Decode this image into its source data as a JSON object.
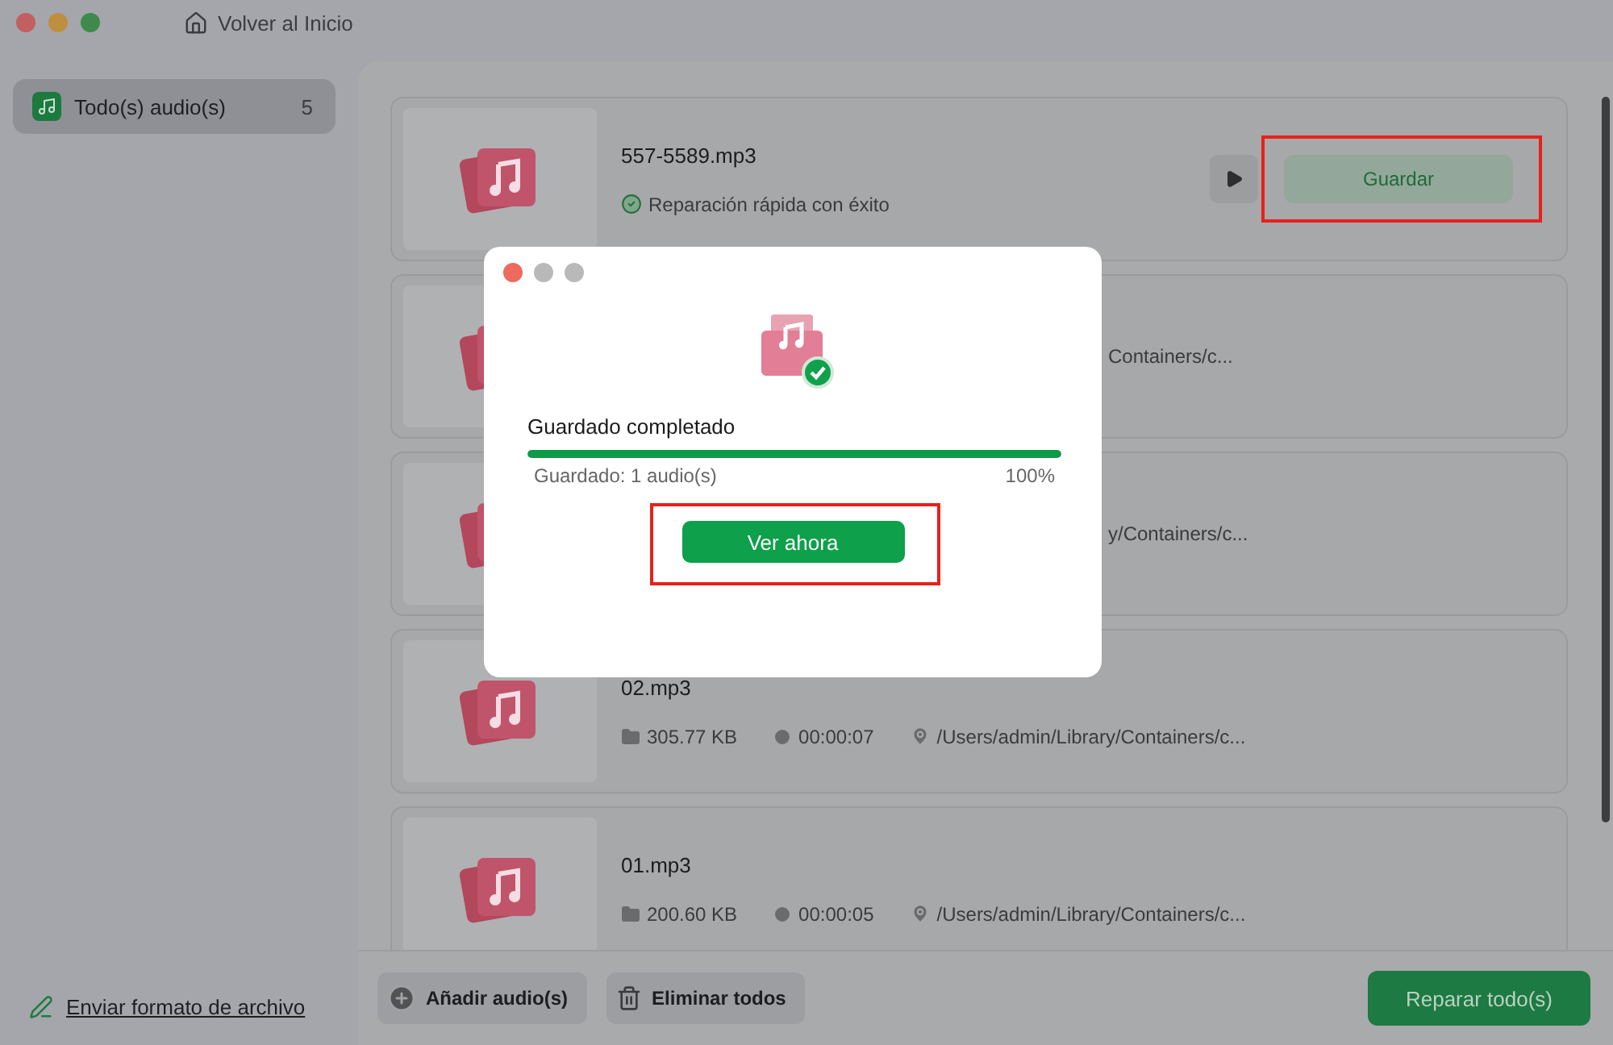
{
  "window": {
    "title": "Volver al Inicio"
  },
  "sidebar": {
    "items": [
      {
        "label": "Todo(s) audio(s)",
        "count": "5",
        "selected": true
      }
    ],
    "footer_link": "Enviar formato de archivo"
  },
  "files": [
    {
      "kind": "repaired",
      "name": "557-5589.mp3",
      "status": "Reparación rápida con éxito",
      "save": {
        "label": "Guardar",
        "highlighted": true
      }
    },
    {
      "kind": "covered",
      "path": "Containers/c..."
    },
    {
      "kind": "covered",
      "path": "y/Containers/c..."
    },
    {
      "kind": "details",
      "name": "02.mp3",
      "size": "305.77 KB",
      "duration": "00:00:07",
      "path": "/Users/admin/Library/Containers/c..."
    },
    {
      "kind": "details",
      "name": "01.mp3",
      "size": "200.60 KB",
      "duration": "00:00:05",
      "path": "/Users/admin/Library/Containers/c..."
    }
  ],
  "bottom_bar": {
    "add": "Añadir audio(s)",
    "clear": "Eliminar todos",
    "repair_all": "Reparar todo(s)"
  },
  "dialog": {
    "title": "Guardado completado",
    "level": 1,
    "saved": "Guardado: 1 audio(s)",
    "percent": "100%",
    "button": {
      "label": "Ver ahora",
      "highlighted": true
    }
  }
}
